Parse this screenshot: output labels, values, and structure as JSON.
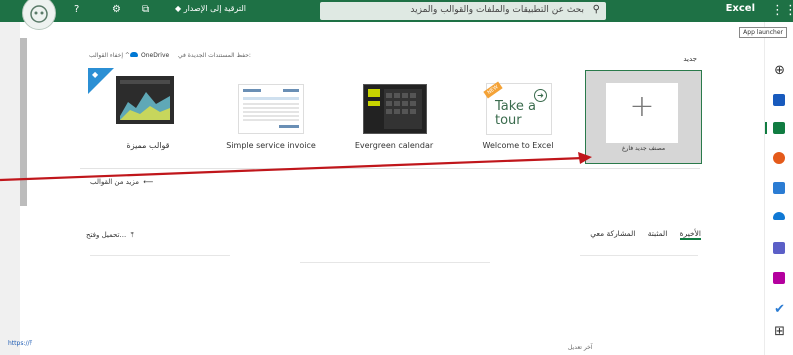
{
  "topbar": {
    "brand": "Excel",
    "launcher_tooltip": "App launcher",
    "search_placeholder": "بحث عن التطبيقات والملفات والقوالب والمزيد",
    "upgrade": "الترقية إلى الإصدار",
    "help": "?",
    "colors": {
      "bar": "#1e7145",
      "accent": "#107c41"
    }
  },
  "header": {
    "new_label": "جديد",
    "save_note": "حفظ المستندات الجديدة في:",
    "onedrive": "OneDrive",
    "hide_templates": "إخفاء القوالب ^"
  },
  "templates": [
    {
      "label": "مصنف جديد فارغ",
      "icon": "plus-icon"
    },
    {
      "label": "Welcome to Excel",
      "thumb_text": "Take a tour",
      "ribbon": "NEW"
    },
    {
      "label": "Evergreen calendar"
    },
    {
      "label": "Simple service invoice"
    },
    {
      "label": "قوالب مميزة",
      "badge": "diamond-icon"
    }
  ],
  "more_templates": "مزيد من القوالب",
  "tabs": [
    "الأخيرة",
    "المثبتة",
    "المشاركة معي"
  ],
  "upload": "تحميل وفتح...",
  "status_url": "https://",
  "footer_text": "آخر تعديل"
}
